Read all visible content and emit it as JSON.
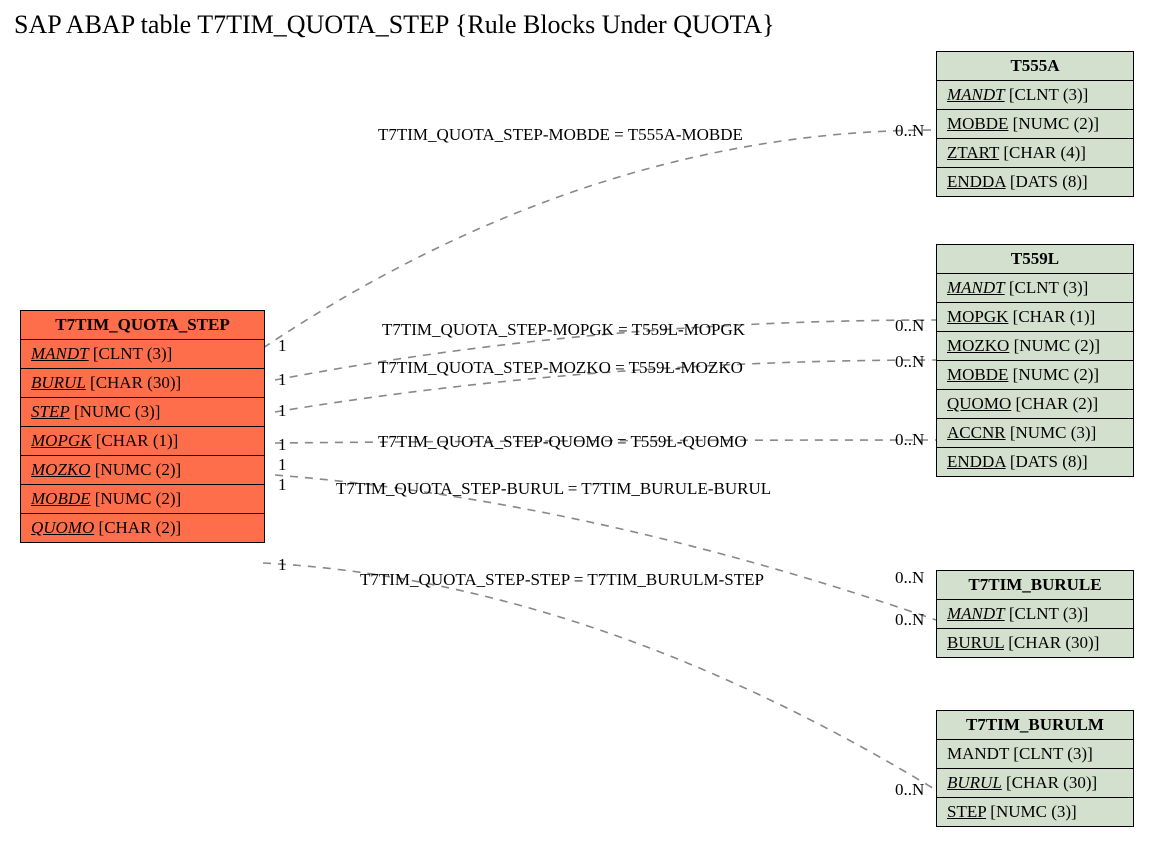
{
  "title": "SAP ABAP table T7TIM_QUOTA_STEP {Rule Blocks Under QUOTA}",
  "main": {
    "name": "T7TIM_QUOTA_STEP",
    "fields": [
      {
        "name": "MANDT",
        "type": "[CLNT (3)]",
        "style": "fk"
      },
      {
        "name": "BURUL",
        "type": "[CHAR (30)]",
        "style": "fk"
      },
      {
        "name": "STEP",
        "type": "[NUMC (3)]",
        "style": "fk"
      },
      {
        "name": "MOPGK",
        "type": "[CHAR (1)]",
        "style": "fk"
      },
      {
        "name": "MOZKO",
        "type": "[NUMC (2)]",
        "style": "fk"
      },
      {
        "name": "MOBDE",
        "type": "[NUMC (2)]",
        "style": "fk"
      },
      {
        "name": "QUOMO",
        "type": "[CHAR (2)]",
        "style": "fk"
      }
    ]
  },
  "refs": {
    "t555a": {
      "name": "T555A",
      "fields": [
        {
          "name": "MANDT",
          "type": "[CLNT (3)]",
          "style": "fk"
        },
        {
          "name": "MOBDE",
          "type": "[NUMC (2)]",
          "style": "pk"
        },
        {
          "name": "ZTART",
          "type": "[CHAR (4)]",
          "style": "pk"
        },
        {
          "name": "ENDDA",
          "type": "[DATS (8)]",
          "style": "pk"
        }
      ]
    },
    "t559l": {
      "name": "T559L",
      "fields": [
        {
          "name": "MANDT",
          "type": "[CLNT (3)]",
          "style": "fk"
        },
        {
          "name": "MOPGK",
          "type": "[CHAR (1)]",
          "style": "pk"
        },
        {
          "name": "MOZKO",
          "type": "[NUMC (2)]",
          "style": "pk"
        },
        {
          "name": "MOBDE",
          "type": "[NUMC (2)]",
          "style": "pk"
        },
        {
          "name": "QUOMO",
          "type": "[CHAR (2)]",
          "style": "pk"
        },
        {
          "name": "ACCNR",
          "type": "[NUMC (3)]",
          "style": "pk"
        },
        {
          "name": "ENDDA",
          "type": "[DATS (8)]",
          "style": "pk"
        }
      ]
    },
    "t7tim_burule": {
      "name": "T7TIM_BURULE",
      "fields": [
        {
          "name": "MANDT",
          "type": "[CLNT (3)]",
          "style": "fk"
        },
        {
          "name": "BURUL",
          "type": "[CHAR (30)]",
          "style": "pk"
        }
      ]
    },
    "t7tim_burulm": {
      "name": "T7TIM_BURULM",
      "fields": [
        {
          "name": "MANDT",
          "type": "[CLNT (3)]",
          "style": ""
        },
        {
          "name": "BURUL",
          "type": "[CHAR (30)]",
          "style": "fk"
        },
        {
          "name": "STEP",
          "type": "[NUMC (3)]",
          "style": "pk"
        }
      ]
    }
  },
  "relationships": [
    {
      "label": "T7TIM_QUOTA_STEP-MOBDE = T555A-MOBDE"
    },
    {
      "label": "T7TIM_QUOTA_STEP-MOPGK = T559L-MOPGK"
    },
    {
      "label": "T7TIM_QUOTA_STEP-MOZKO = T559L-MOZKO"
    },
    {
      "label": "T7TIM_QUOTA_STEP-QUOMO = T559L-QUOMO"
    },
    {
      "label": "T7TIM_QUOTA_STEP-BURUL = T7TIM_BURULE-BURUL"
    },
    {
      "label": "T7TIM_QUOTA_STEP-STEP = T7TIM_BURULM-STEP"
    }
  ],
  "cardinality": {
    "one": "1",
    "many": "0..N"
  }
}
